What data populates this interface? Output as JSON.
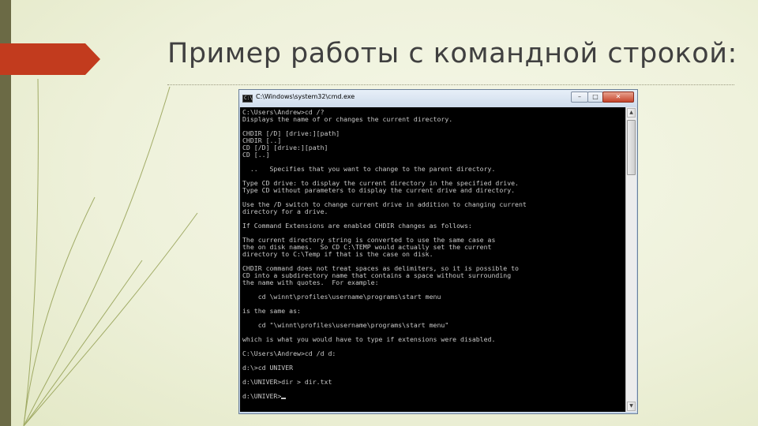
{
  "slide": {
    "title": "Пример работы с командной строкой:"
  },
  "window": {
    "title": "C:\\Windows\\system32\\cmd.exe",
    "icon_text": "C:\\",
    "buttons": {
      "minimize": "–",
      "maximize": "□",
      "close": "✕"
    }
  },
  "console": {
    "lines": [
      "C:\\Users\\Andrew>cd /?",
      "Displays the name of or changes the current directory.",
      "",
      "CHDIR [/D] [drive:][path]",
      "CHDIR [..]",
      "CD [/D] [drive:][path]",
      "CD [..]",
      "",
      "  ..   Specifies that you want to change to the parent directory.",
      "",
      "Type CD drive: to display the current directory in the specified drive.",
      "Type CD without parameters to display the current drive and directory.",
      "",
      "Use the /D switch to change current drive in addition to changing current",
      "directory for a drive.",
      "",
      "If Command Extensions are enabled CHDIR changes as follows:",
      "",
      "The current directory string is converted to use the same case as",
      "the on disk names.  So CD C:\\TEMP would actually set the current",
      "directory to C:\\Temp if that is the case on disk.",
      "",
      "CHDIR command does not treat spaces as delimiters, so it is possible to",
      "CD into a subdirectory name that contains a space without surrounding",
      "the name with quotes.  For example:",
      "",
      "    cd \\winnt\\profiles\\username\\programs\\start menu",
      "",
      "is the same as:",
      "",
      "    cd \"\\winnt\\profiles\\username\\programs\\start menu\"",
      "",
      "which is what you would have to type if extensions were disabled.",
      "",
      "C:\\Users\\Andrew>cd /d d:",
      "",
      "d:\\>cd UNIVER",
      "",
      "d:\\UNIVER>dir > dir.txt",
      "",
      "d:\\UNIVER>"
    ]
  }
}
